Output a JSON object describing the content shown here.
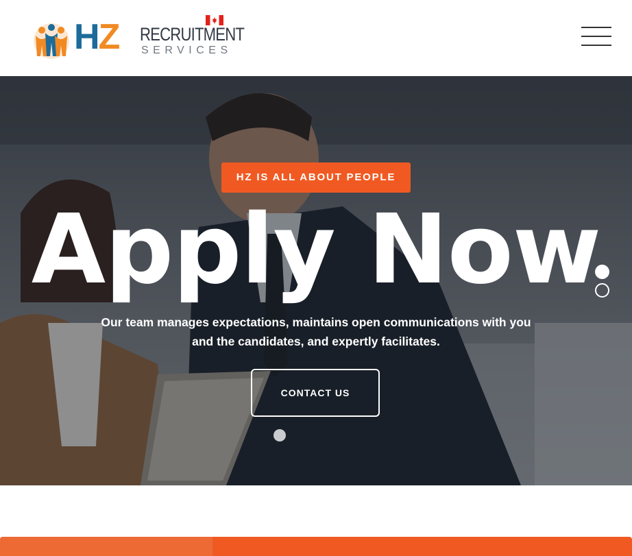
{
  "header": {
    "logo": {
      "hz_h": "H",
      "hz_z": "Z",
      "recruitment": "RECRUITMENT",
      "services": "SERVICES"
    },
    "menu_icon": "hamburger-menu-icon"
  },
  "hero": {
    "tag": "HZ IS ALL ABOUT PEOPLE",
    "headline": "Apply Now",
    "subtext": "Our team manages expectations, maintains open communications with you and the candidates, and expertly facilitates.",
    "cta_label": "CONTACT US",
    "slides": {
      "count": 2,
      "active": 1
    }
  },
  "colors": {
    "accent_orange": "#f05a22",
    "brand_blue": "#1d6b9a",
    "brand_orange": "#f08a24",
    "overlay": "rgba(20,24,30,0.45)"
  }
}
